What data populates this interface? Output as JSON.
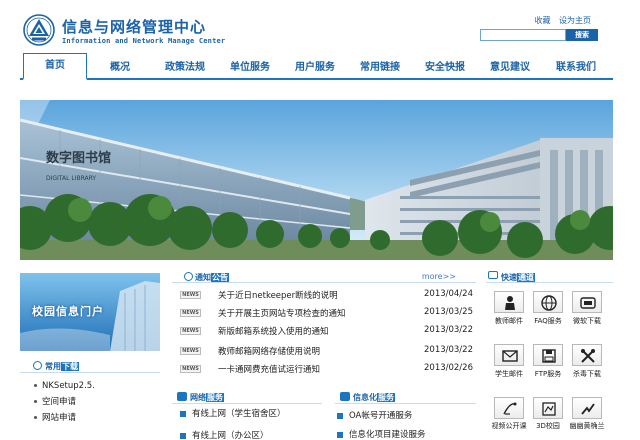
{
  "header": {
    "title_cn": "信息与网络管理中心",
    "title_en": "Information and Network Manage Center",
    "links": [
      "收藏",
      "设为主页"
    ],
    "search": {
      "placeholder": "",
      "button": "搜索"
    }
  },
  "nav": {
    "items": [
      "首页",
      "概况",
      "政策法规",
      "单位服务",
      "用户服务",
      "常用链接",
      "安全快报",
      "意见建议",
      "联系我们"
    ],
    "active": "首页"
  },
  "banner": {
    "sign_cn": "数字图书馆",
    "sign_en": "DIGITAL LIBRARY"
  },
  "left": {
    "portal_text": "校园信息门户",
    "quick": {
      "title": "常用",
      "title_highlight": "下载"
    },
    "downloads": [
      "NKSetup2.5.",
      "空间申请",
      "网站申请"
    ]
  },
  "news": {
    "title": "通知",
    "title_highlight": "公告",
    "more": "more>>",
    "badge": "NEWS",
    "items": [
      {
        "text": "关于近日netkeeper断线的说明",
        "date": "2013/04/24"
      },
      {
        "text": "关于开展主页网站专项检查的通知",
        "date": "2013/03/25"
      },
      {
        "text": "新版邮箱系统投入使用的通知",
        "date": "2013/03/22"
      },
      {
        "text": "教师邮箱网络存储使用说明",
        "date": "2013/03/22"
      },
      {
        "text": "一卡通网费充值试运行通知",
        "date": "2013/02/26"
      }
    ]
  },
  "network_service": {
    "title": "网络",
    "title_highlight": "服务",
    "items": [
      "有线上网（学生宿舍区）",
      "有线上网（办公区）"
    ]
  },
  "info_service": {
    "title": "信息化",
    "title_highlight": "服务",
    "items": [
      "OA帐号开通服务",
      "信息化项目建设服务"
    ]
  },
  "fast": {
    "title": "快速",
    "title_highlight": "通道",
    "tiles": [
      {
        "label": "教师邮件",
        "icon": "teacher-mail-icon"
      },
      {
        "label": "FAQ服务",
        "icon": "faq-icon"
      },
      {
        "label": "微软下载",
        "icon": "microsoft-download-icon"
      },
      {
        "label": "学生邮件",
        "icon": "student-mail-icon"
      },
      {
        "label": "FTP服务",
        "icon": "ftp-icon"
      },
      {
        "label": "杀毒下载",
        "icon": "antivirus-icon"
      },
      {
        "label": "视频公开课",
        "icon": "video-course-icon"
      },
      {
        "label": "3D校园",
        "icon": "campus-3d-icon"
      },
      {
        "label": "幽幽黄桷兰",
        "icon": "forum-icon"
      }
    ]
  },
  "colors": {
    "brand": "#1b63a8",
    "accent": "#1b75c0"
  }
}
